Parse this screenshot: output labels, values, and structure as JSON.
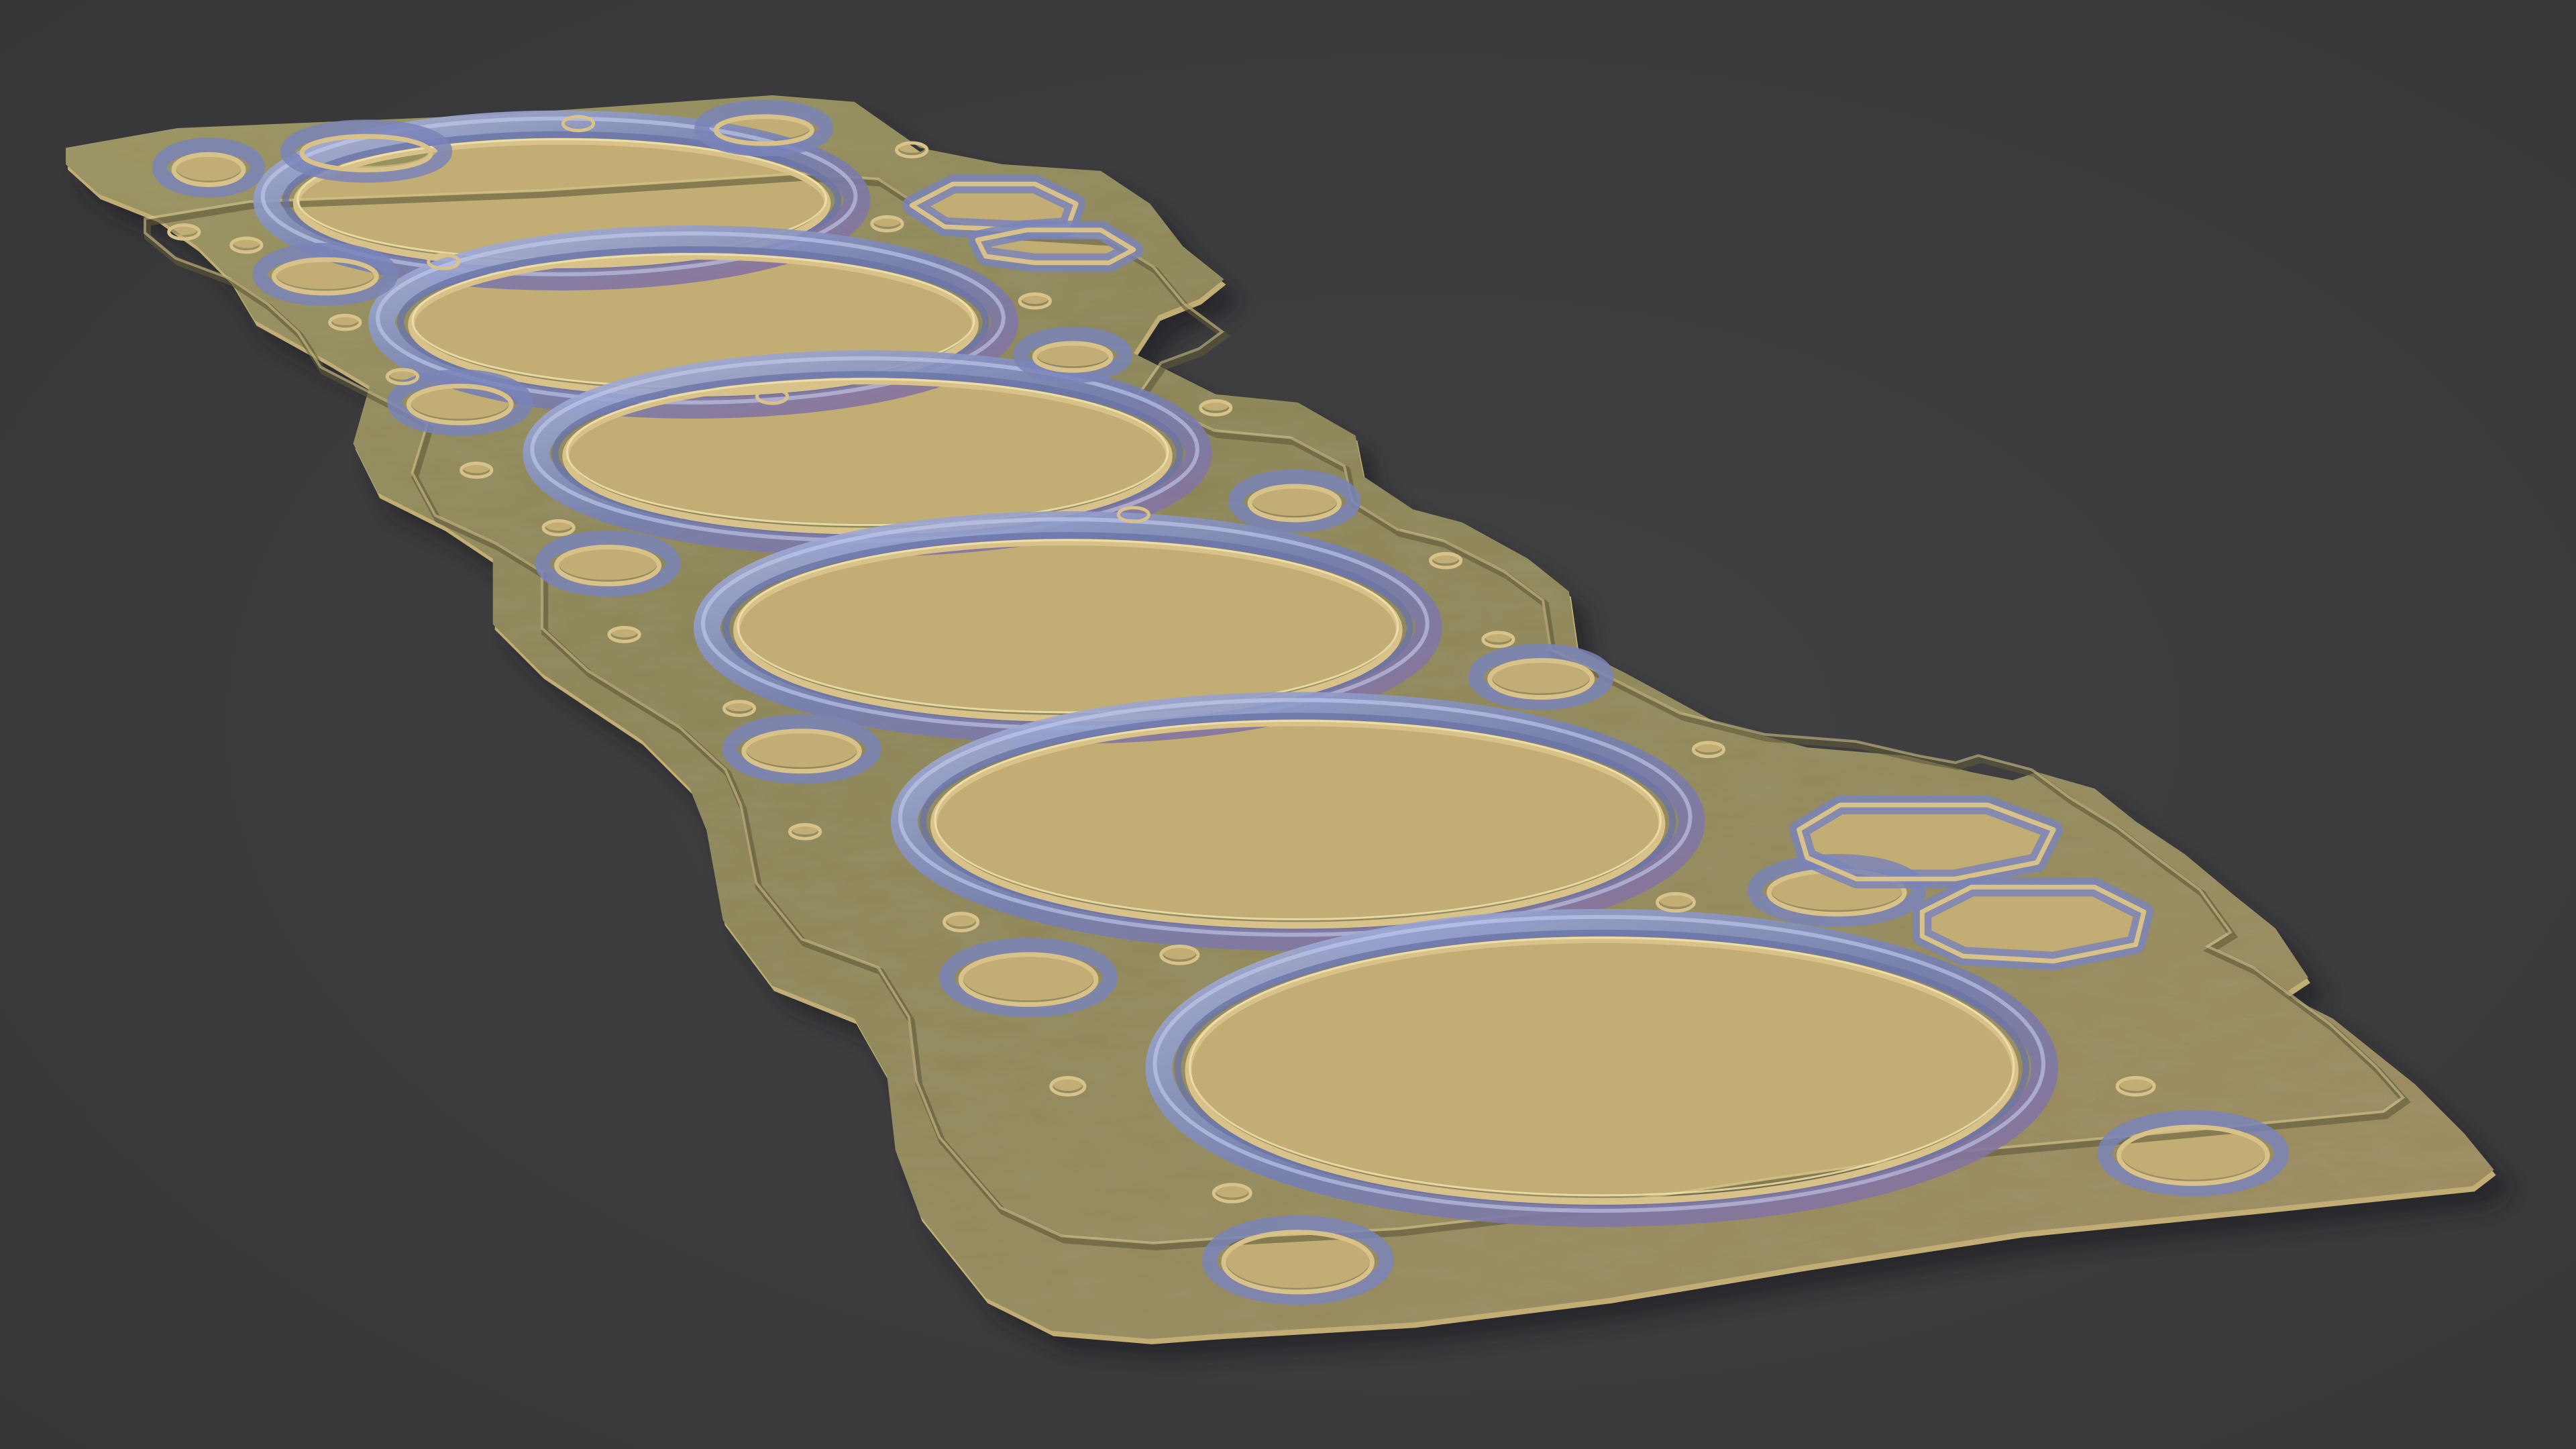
{
  "scene": {
    "subject": "cylinder-head-gasket",
    "background_color": "#3b3b3d",
    "gasket_colors": {
      "body": "#8d8552",
      "body_light": "#b3a66c",
      "body_dark": "#6b6440",
      "edge": "#c9b37a",
      "bead_blue": "#7c86b8",
      "bead_blue_light": "#a9b3dd",
      "bead_violet": "#8a6f9a",
      "hole_dark": "#2f2f31",
      "hole_rim": "#d8c28a"
    },
    "cylinder_bores": 6
  }
}
